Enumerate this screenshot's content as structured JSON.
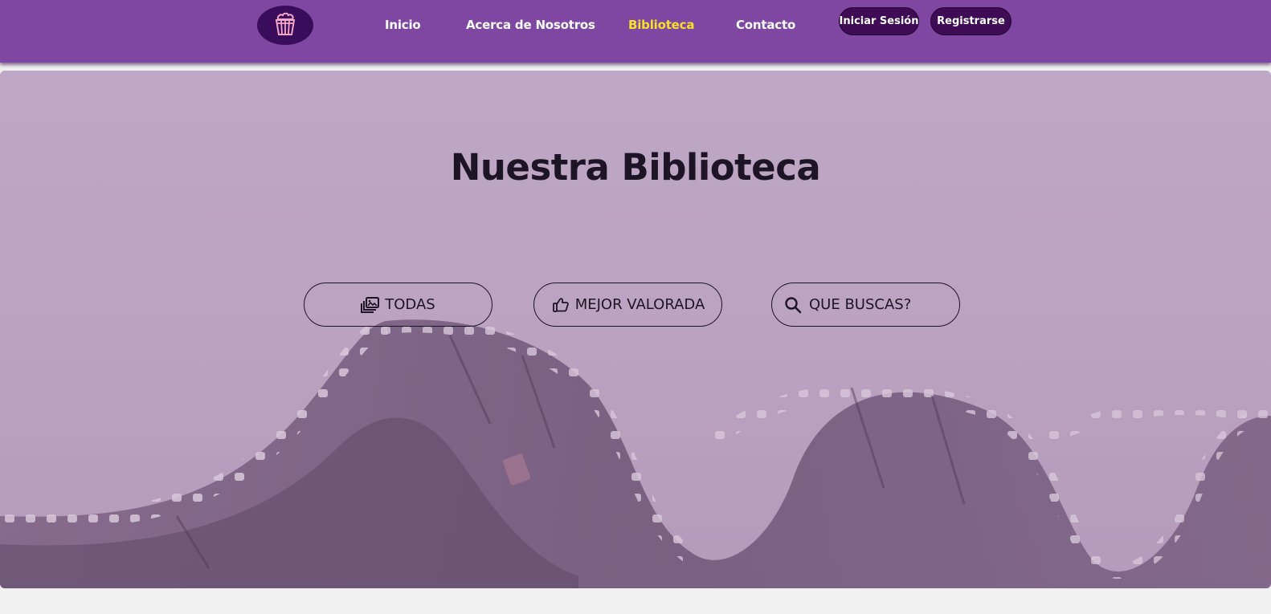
{
  "nav": {
    "logo_icon": "popcorn-icon",
    "links": [
      {
        "label": "Inicio",
        "active": false
      },
      {
        "label": "Acerca de Nosotros",
        "active": false
      },
      {
        "label": "Biblioteca",
        "active": true
      },
      {
        "label": "Contacto",
        "active": false
      }
    ],
    "login_label": "Iniciar Sesión",
    "register_label": "Registrarse"
  },
  "hero": {
    "title": "Nuestra Biblioteca",
    "background": "film-strip-image",
    "filters": [
      {
        "label": "TODAS",
        "icon": "photo-gallery-icon"
      },
      {
        "label": "MEJOR VALORADA",
        "icon": "thumbs-up-icon"
      },
      {
        "label": "QUE BUSCAS?",
        "icon": "search-icon"
      }
    ]
  },
  "colors": {
    "nav_bg": "#7f47a1",
    "active_link": "#f7e02c",
    "button_bg": "#3f0b55",
    "hero_overlay": "#bea7c4",
    "text_dark": "#1d1426"
  }
}
